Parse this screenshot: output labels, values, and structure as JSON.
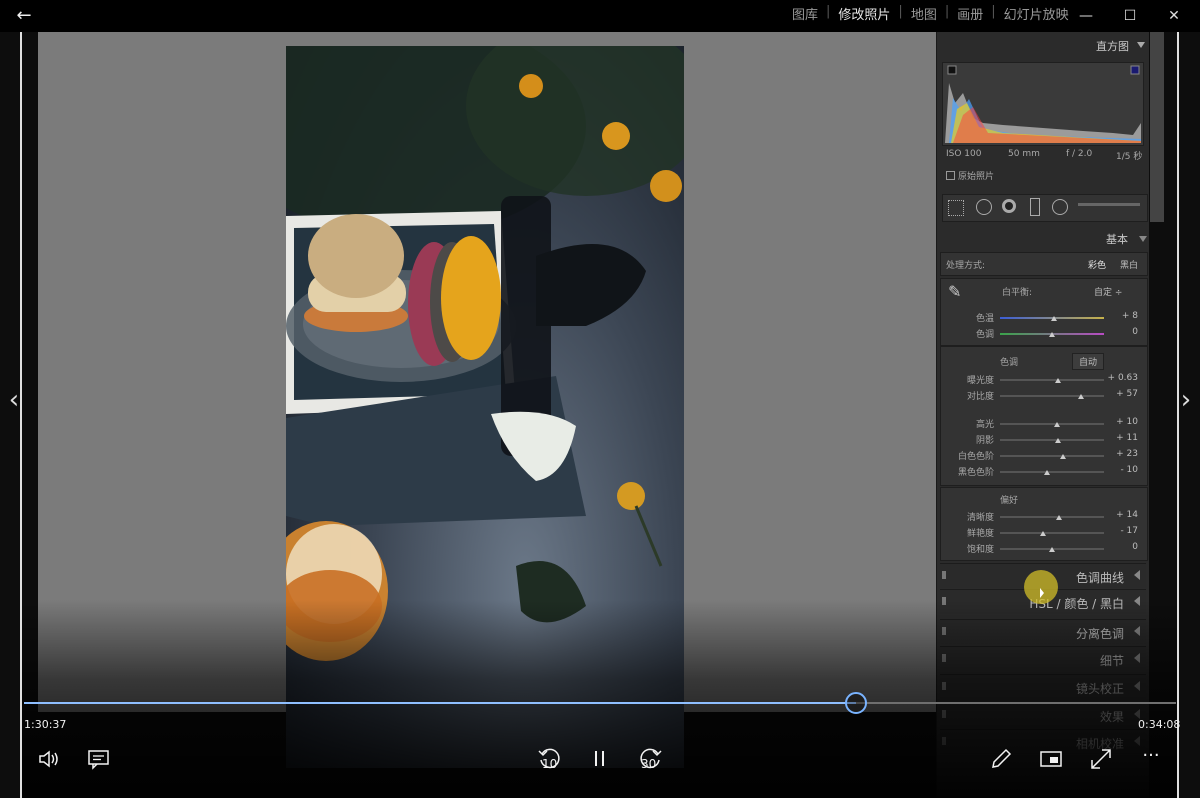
{
  "window": {
    "back_icon": "back-arrow-icon",
    "minimize": "—",
    "maximize": "☐",
    "close": "✕"
  },
  "lightroom": {
    "modules": [
      "图库",
      "修改照片",
      "地图",
      "画册",
      "幻灯片放映"
    ],
    "active_module": "修改照片",
    "histogram": {
      "title": "直方图",
      "iso": "ISO 100",
      "focal": "50 mm",
      "aperture": "f / 2.0",
      "shutter": "1/5 秒",
      "original_label": "原始照片"
    },
    "basic": {
      "title": "基本",
      "treatment_label": "处理方式:",
      "treatment_color": "彩色",
      "treatment_bw": "黑白",
      "wb_label": "白平衡:",
      "wb_value": "自定 ÷",
      "sliders_wb": [
        {
          "label": "色温",
          "value": "+ 8",
          "pos": 0.52
        },
        {
          "label": "色调",
          "value": "0",
          "pos": 0.5
        }
      ],
      "tone_label": "色调",
      "auto_label": "自动",
      "sliders_tone1": [
        {
          "label": "曝光度",
          "value": "+ 0.63",
          "pos": 0.56
        },
        {
          "label": "对比度",
          "value": "+ 57",
          "pos": 0.78
        }
      ],
      "sliders_tone2": [
        {
          "label": "高光",
          "value": "+ 10",
          "pos": 0.55
        },
        {
          "label": "阴影",
          "value": "+ 11",
          "pos": 0.56
        },
        {
          "label": "白色色阶",
          "value": "+ 23",
          "pos": 0.61
        },
        {
          "label": "黑色色阶",
          "value": "- 10",
          "pos": 0.45
        }
      ],
      "presence_label": "偏好",
      "sliders_presence": [
        {
          "label": "清晰度",
          "value": "+ 14",
          "pos": 0.57
        },
        {
          "label": "鲜艳度",
          "value": "- 17",
          "pos": 0.41
        },
        {
          "label": "饱和度",
          "value": "0",
          "pos": 0.5
        }
      ]
    },
    "collapsed_panels": [
      "色调曲线",
      "HSL / 颜色 / 黑白",
      "分离色调",
      "细节",
      "镜头校正",
      "效果",
      "相机校准"
    ]
  },
  "player": {
    "current_time": "1:30:37",
    "remaining_time": "0:34:08",
    "progress": 0.722,
    "skip_back": "10",
    "skip_forward": "30"
  },
  "colors": {
    "accent": "#79b3ff",
    "panel_bg": "#2b2b2b",
    "canvas_bg": "#7b7b7b"
  }
}
